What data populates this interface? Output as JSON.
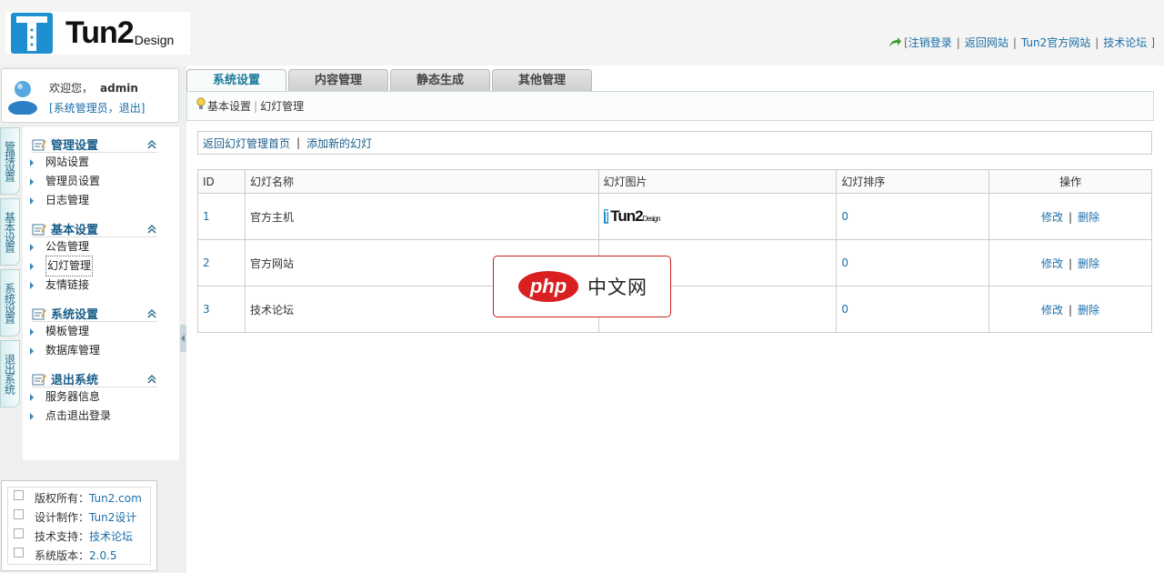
{
  "header": {
    "logo_text": "Tun2",
    "logo_sub": "Design",
    "links": [
      "注销登录",
      "返回网站",
      "Tun2官方网站",
      "技术论坛"
    ],
    "bracket_open": "[",
    "bracket_close": "]"
  },
  "user": {
    "welcome": "欢迎您，",
    "name": "admin",
    "role_line_open": "[",
    "role": "系统管理员",
    "comma": "，",
    "logout": "退出",
    "role_line_close": "]"
  },
  "vertical_tabs": [
    "管理设置",
    "基本设置",
    "系统设置",
    "退出系统"
  ],
  "menu": {
    "groups": [
      {
        "title": "管理设置",
        "items": [
          "网站设置",
          "管理员设置",
          "日志管理"
        ]
      },
      {
        "title": "基本设置",
        "items": [
          "公告管理",
          "幻灯管理",
          "友情链接"
        ]
      },
      {
        "title": "系统设置",
        "items": [
          "模板管理",
          "数据库管理"
        ]
      },
      {
        "title": "退出系统",
        "items": [
          "服务器信息",
          "点击退出登录"
        ]
      }
    ]
  },
  "info": [
    {
      "label": "版权所有：",
      "value": "Tun2.com"
    },
    {
      "label": "设计制作：",
      "value": "Tun2设计"
    },
    {
      "label": "技术支持：",
      "value": "技术论坛"
    },
    {
      "label": "系统版本：",
      "value": "2.0.5"
    }
  ],
  "tabs": [
    "系统设置",
    "内容管理",
    "静态生成",
    "其他管理"
  ],
  "breadcrumb": [
    "基本设置",
    "幻灯管理"
  ],
  "actions": [
    "返回幻灯管理首页",
    "添加新的幻灯"
  ],
  "table": {
    "headers": [
      "ID",
      "幻灯名称",
      "幻灯图片",
      "幻灯排序",
      "操作"
    ],
    "rows": [
      {
        "id": "1",
        "name": "官方主机",
        "sort": "0"
      },
      {
        "id": "2",
        "name": "官方网站",
        "sort": "0"
      },
      {
        "id": "3",
        "name": "技术论坛",
        "sort": "0"
      }
    ],
    "edit_label": "修改",
    "delete_label": "删除",
    "op_sep": "|"
  },
  "thumb_text": "Tun2",
  "thumb_sub": "Design",
  "watermark": {
    "logo": "php",
    "text": "中文网"
  },
  "colors": {
    "link": "#1a6fa8",
    "accent": "#1a7a9a",
    "watermark_red": "#d91f1f"
  }
}
